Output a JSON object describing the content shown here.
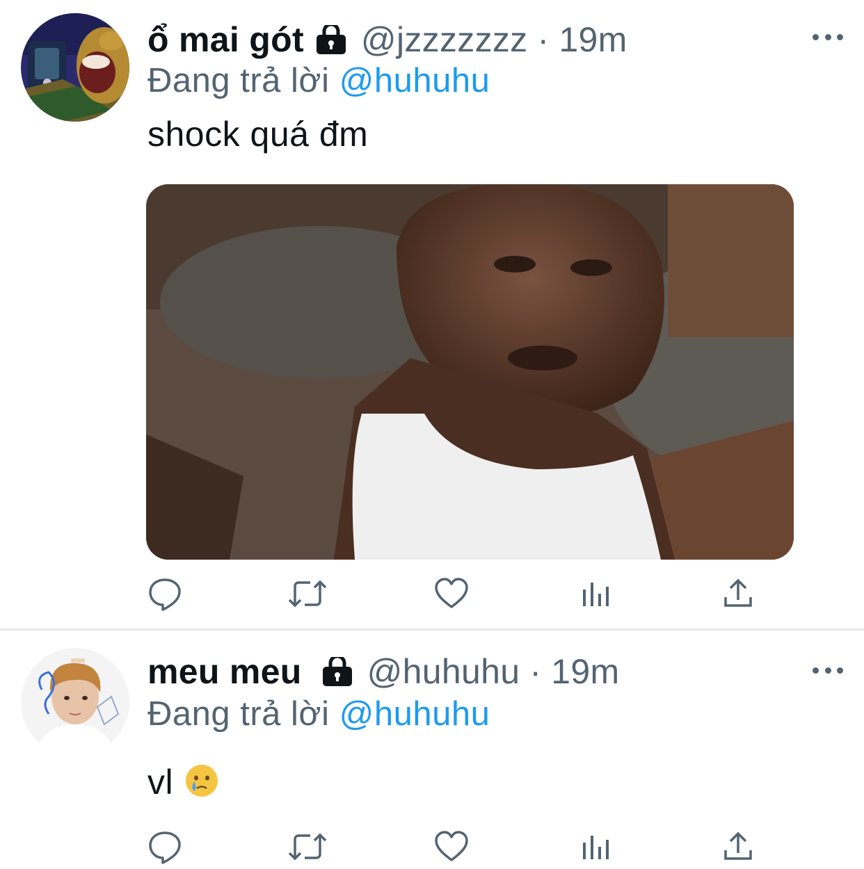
{
  "tweets": [
    {
      "display_name": "ổ mai gót",
      "handle": "@jzzzzzzz",
      "separator": "·",
      "time": "19m",
      "reply_prefix": "Đang trả lời",
      "reply_to": "@huhuhu",
      "text": "shock quá đm",
      "protected": true,
      "avatar": "cartoon-character-avatar",
      "media": "meme-photo-man-in-white-tank-top"
    },
    {
      "display_name": "meu meu",
      "handle": "@huhuhu",
      "separator": "·",
      "time": "19m",
      "reply_prefix": "Đang trả lời",
      "reply_to": "@huhuhu",
      "text": "vl",
      "emoji": "crying-face-emoji",
      "protected": true,
      "avatar": "person-photo-avatar"
    }
  ],
  "actions": [
    "reply-icon",
    "retweet-icon",
    "like-icon",
    "analytics-icon",
    "share-icon"
  ],
  "colors": {
    "text": "#0f1419",
    "secondary": "#536471",
    "link": "#1d9bf0",
    "divider": "#e6e9ec"
  }
}
